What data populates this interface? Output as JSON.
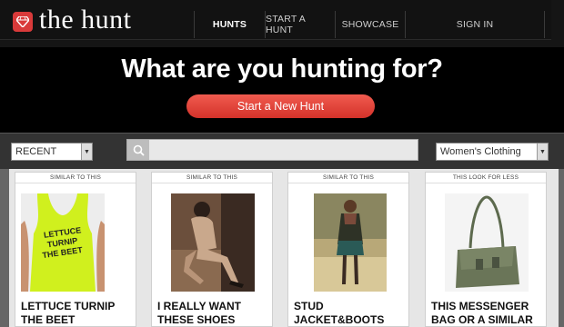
{
  "brand": {
    "name": "the hunt"
  },
  "nav": {
    "items": [
      {
        "label": "HUNTS",
        "active": true
      },
      {
        "label": "START A HUNT",
        "active": false
      },
      {
        "label": "SHOWCASE",
        "active": false
      },
      {
        "label": "SIGN IN",
        "active": false
      }
    ]
  },
  "hero": {
    "title": "What are you hunting for?",
    "cta_label": "Start a New Hunt"
  },
  "filters": {
    "sort_value": "RECENT",
    "category_value": "Women's Clothing",
    "search_placeholder": ""
  },
  "cards": [
    {
      "tag": "SIMILAR TO THIS",
      "title": "LETTUCE TURNIP THE BEET",
      "image_text": "LETTUCE TURNIP THE BEET"
    },
    {
      "tag": "SIMILAR TO THIS",
      "title": "I REALLY WANT THESE SHOES"
    },
    {
      "tag": "SIMILAR TO THIS",
      "title": "STUD JACKET&BOOTS"
    },
    {
      "tag": "THIS LOOK FOR LESS",
      "title": "THIS MESSENGER BAG OR A SIMILAR ONE"
    }
  ],
  "colors": {
    "accent": "#d93a3a",
    "button": "#e0443a",
    "background": "#000000",
    "content_bg": "#e6e6e6"
  },
  "icons": {
    "logo": "diamond-icon",
    "search": "search-icon",
    "dropdown": "chevron-down-icon"
  }
}
